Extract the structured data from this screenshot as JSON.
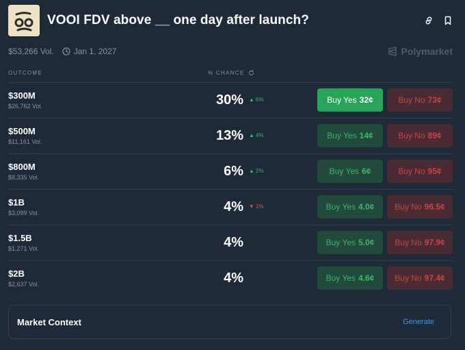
{
  "header": {
    "title": "VOOI FDV above __ one day after launch?"
  },
  "meta": {
    "volume": "$53,266 Vol.",
    "date": "Jan 1, 2027",
    "brand": "Polymarket"
  },
  "columns": {
    "outcome": "OUTCOME",
    "chance": "% CHANCE"
  },
  "outcomes": [
    {
      "name": "$300M",
      "volume": "$26,762 Vol.",
      "chance": "30%",
      "delta": "6%",
      "delta_dir": "up",
      "yes_label": "Buy Yes",
      "yes_price": "32¢",
      "no_label": "Buy No",
      "no_price": "73¢"
    },
    {
      "name": "$500M",
      "volume": "$11,161 Vol.",
      "chance": "13%",
      "delta": "4%",
      "delta_dir": "up",
      "yes_label": "Buy Yes",
      "yes_price": "14¢",
      "no_label": "Buy No",
      "no_price": "89¢"
    },
    {
      "name": "$800M",
      "volume": "$8,335 Vol.",
      "chance": "6%",
      "delta": "2%",
      "delta_dir": "up",
      "yes_label": "Buy Yes",
      "yes_price": "6¢",
      "no_label": "Buy No",
      "no_price": "95¢"
    },
    {
      "name": "$1B",
      "volume": "$3,099 Vol.",
      "chance": "4%",
      "delta": "1%",
      "delta_dir": "down",
      "yes_label": "Buy Yes",
      "yes_price": "4.0¢",
      "no_label": "Buy No",
      "no_price": "96.5¢"
    },
    {
      "name": "$1.5B",
      "volume": "$1,271 Vol.",
      "chance": "4%",
      "delta": "",
      "delta_dir": "",
      "yes_label": "Buy Yes",
      "yes_price": "5.0¢",
      "no_label": "Buy No",
      "no_price": "97.9¢"
    },
    {
      "name": "$2B",
      "volume": "$2,637 Vol.",
      "chance": "4%",
      "delta": "",
      "delta_dir": "",
      "yes_label": "Buy Yes",
      "yes_price": "4.6¢",
      "no_label": "Buy No",
      "no_price": "97.4¢"
    }
  ],
  "context": {
    "title": "Market Context",
    "action": "Generate"
  },
  "colors": {
    "background": "#1e2a38",
    "yes": "#27a35a",
    "no": "#c84646",
    "link": "#3a9be8"
  },
  "icons": {
    "header": [
      "link-icon",
      "bookmark-icon"
    ],
    "meta": "clock-icon",
    "brand": "polymarket-logo-icon",
    "chance": "refresh-icon"
  }
}
